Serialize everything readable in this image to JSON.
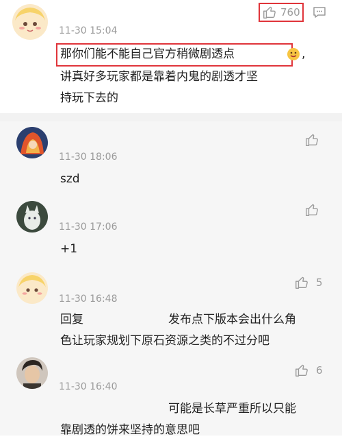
{
  "main_comment": {
    "timestamp": "11-30 15:04",
    "likes": "760",
    "text_line1": "那你们能不能自己官方稍微剧透点",
    "text_line1_tail": ",",
    "text_line2": "讲真好多玩家都是靠着内鬼的剧透才坚",
    "text_line3": "持玩下去的"
  },
  "replies": [
    {
      "timestamp": "11-30 18:06",
      "text": "szd",
      "likes": ""
    },
    {
      "timestamp": "11-30 17:06",
      "text": "+1",
      "likes": ""
    },
    {
      "timestamp": "11-30 16:48",
      "likes": "5",
      "line1_prefix": "回复",
      "line1_suffix": "发布点下版本会出什么角",
      "line2": "色让玩家规划下原石资源之类的不过分吧"
    },
    {
      "timestamp": "11-30 16:40",
      "likes": "6",
      "line1": "可能是长草严重所以只能",
      "line2": "靠剧透的饼来坚持的意思吧"
    }
  ],
  "icons": {
    "like": "thumbs-up-icon",
    "comment": "comment-bubble-icon",
    "emoji": "emoji-icon"
  },
  "colors": {
    "highlight_box": "#e0343a",
    "meta_text": "#9a9a9a"
  }
}
